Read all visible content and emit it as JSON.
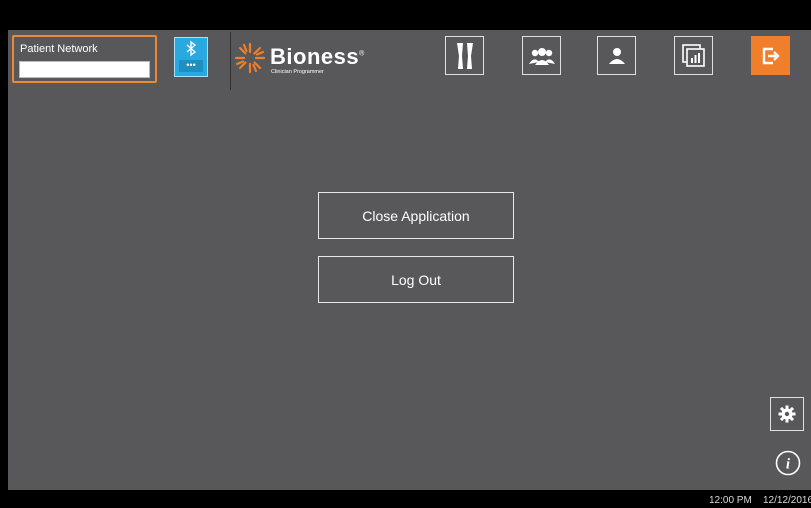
{
  "header": {
    "patient_network": {
      "label": "Patient Network",
      "value": "",
      "highlight_color": "#e98a3a"
    },
    "bluetooth": {
      "icon": "bluetooth-icon",
      "dots": "•••",
      "color": "#29a9e0"
    },
    "logo": {
      "brand": "Bioness",
      "registered": "®",
      "subtitle": "Clinician Programmer",
      "icon": "sunburst-logo-icon",
      "color": "#f07e2a"
    },
    "nav": [
      {
        "icon": "legs-icon"
      },
      {
        "icon": "group-icon"
      },
      {
        "icon": "user-icon"
      },
      {
        "icon": "reports-icon"
      },
      {
        "icon": "exit-icon",
        "active": true
      }
    ]
  },
  "main": {
    "close_application_label": "Close Application",
    "log_out_label": "Log Out"
  },
  "corner": {
    "settings_icon": "gear-icon",
    "info_icon": "info-icon"
  },
  "statusbar": {
    "time": "12:00 PM",
    "date": "12/12/2016"
  },
  "colors": {
    "background": "#58585a",
    "accent": "#f07e2a"
  }
}
